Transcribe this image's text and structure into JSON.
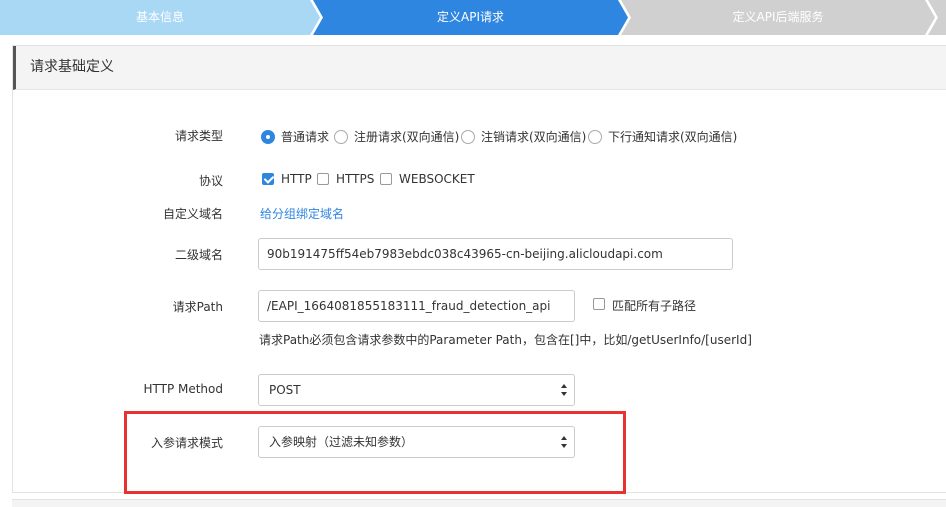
{
  "steps": [
    {
      "label": "基本信息",
      "state": "done"
    },
    {
      "label": "定义API请求",
      "state": "active"
    },
    {
      "label": "定义API后端服务",
      "state": "todo"
    }
  ],
  "colors": {
    "step_done": "#a9d8f5",
    "step_active": "#2f86e0",
    "step_todo": "#d0d0d0",
    "accent": "#2f86e0",
    "highlight": "#e8322f"
  },
  "panel": {
    "title": "请求基础定义"
  },
  "form": {
    "request_type": {
      "label": "请求类型",
      "options": [
        "普通请求",
        "注册请求(双向通信)",
        "注销请求(双向通信)",
        "下行通知请求(双向通信)"
      ],
      "selected": "普通请求"
    },
    "protocol": {
      "label": "协议",
      "options": [
        "HTTP",
        "HTTPS",
        "WEBSOCKET"
      ],
      "checked": [
        "HTTP"
      ]
    },
    "custom_domain": {
      "label": "自定义域名",
      "link": "给分组绑定域名"
    },
    "subdomain": {
      "label": "二级域名",
      "value": "90b191475ff54eb7983ebdc038c43965-cn-beijing.alicloudapi.com"
    },
    "path": {
      "label": "请求Path",
      "value": "/EAPI_1664081855183111_fraud_detection_api",
      "match_all_label": "匹配所有子路径",
      "hint": "请求Path必须包含请求参数中的Parameter Path，包含在[]中，比如/getUserInfo/[userId]"
    },
    "method": {
      "label": "HTTP Method",
      "value": "POST"
    },
    "param_mode": {
      "label": "入参请求模式",
      "value": "入参映射（过滤未知参数）"
    }
  }
}
